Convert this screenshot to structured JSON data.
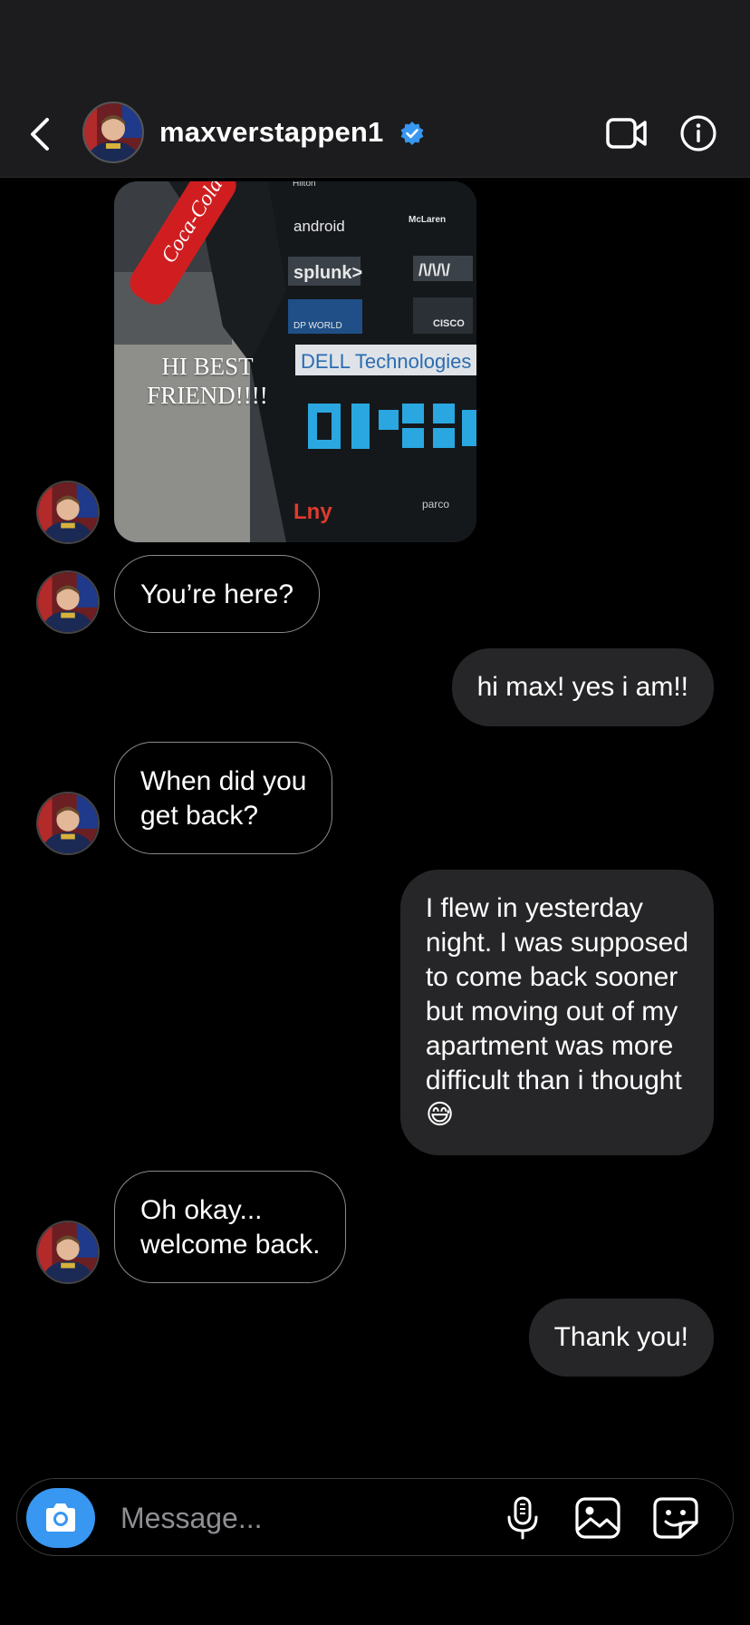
{
  "header": {
    "username": "maxverstappen1",
    "verified": true
  },
  "photo_message": {
    "caption_line1": "HI BEST",
    "caption_line2": "FRIEND!!!!",
    "brand_labels": [
      "Coca-Cola",
      "android",
      "McLaren",
      "splunk>",
      "DP WORLD",
      "CISCO",
      "DELL Technologies",
      "Lny",
      "parco",
      "Hilton"
    ]
  },
  "messages": [
    {
      "direction": "incoming",
      "text": "You’re here?"
    },
    {
      "direction": "outgoing",
      "text": "hi max! yes i am!!"
    },
    {
      "direction": "incoming",
      "line1": "When did you",
      "line2": "get back?"
    },
    {
      "direction": "outgoing",
      "lines": [
        "I flew in yesterday",
        "night. I was supposed",
        "to come back sooner",
        "but moving out of my",
        "apartment was more",
        "difficult than i thought",
        "😅"
      ]
    },
    {
      "direction": "incoming",
      "line1": "Oh okay...",
      "line2": "welcome back."
    },
    {
      "direction": "outgoing",
      "text": "Thank you!"
    }
  ],
  "composer": {
    "placeholder": "Message..."
  },
  "colors": {
    "background": "#000000",
    "header": "#1c1c1e",
    "outgoing_bubble": "#262628",
    "incoming_border": "#8a8a8e",
    "camera_button": "#3897f0",
    "verified_badge": "#3897f0"
  },
  "icons": [
    "back-chevron-icon",
    "verified-badge-icon",
    "video-call-icon",
    "info-icon",
    "camera-icon",
    "microphone-icon",
    "gallery-icon",
    "sticker-icon"
  ]
}
